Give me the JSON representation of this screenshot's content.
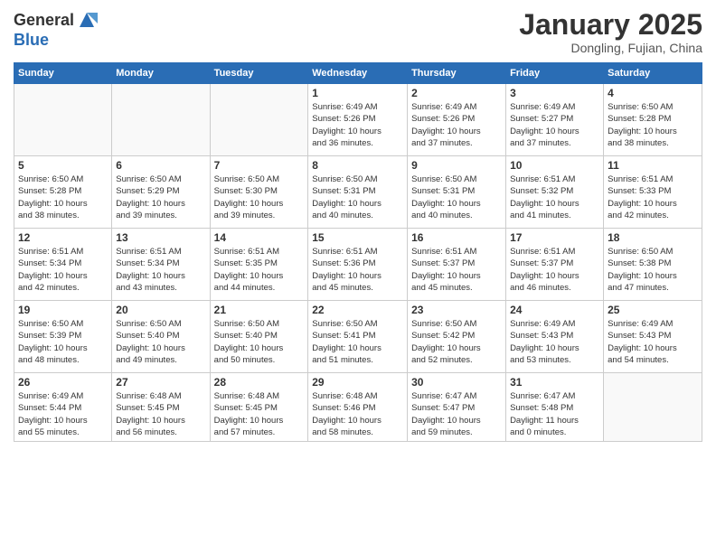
{
  "header": {
    "logo_general": "General",
    "logo_blue": "Blue",
    "month": "January 2025",
    "location": "Dongling, Fujian, China"
  },
  "weekdays": [
    "Sunday",
    "Monday",
    "Tuesday",
    "Wednesday",
    "Thursday",
    "Friday",
    "Saturday"
  ],
  "weeks": [
    [
      {
        "day": "",
        "info": ""
      },
      {
        "day": "",
        "info": ""
      },
      {
        "day": "",
        "info": ""
      },
      {
        "day": "1",
        "info": "Sunrise: 6:49 AM\nSunset: 5:26 PM\nDaylight: 10 hours\nand 36 minutes."
      },
      {
        "day": "2",
        "info": "Sunrise: 6:49 AM\nSunset: 5:26 PM\nDaylight: 10 hours\nand 37 minutes."
      },
      {
        "day": "3",
        "info": "Sunrise: 6:49 AM\nSunset: 5:27 PM\nDaylight: 10 hours\nand 37 minutes."
      },
      {
        "day": "4",
        "info": "Sunrise: 6:50 AM\nSunset: 5:28 PM\nDaylight: 10 hours\nand 38 minutes."
      }
    ],
    [
      {
        "day": "5",
        "info": "Sunrise: 6:50 AM\nSunset: 5:28 PM\nDaylight: 10 hours\nand 38 minutes."
      },
      {
        "day": "6",
        "info": "Sunrise: 6:50 AM\nSunset: 5:29 PM\nDaylight: 10 hours\nand 39 minutes."
      },
      {
        "day": "7",
        "info": "Sunrise: 6:50 AM\nSunset: 5:30 PM\nDaylight: 10 hours\nand 39 minutes."
      },
      {
        "day": "8",
        "info": "Sunrise: 6:50 AM\nSunset: 5:31 PM\nDaylight: 10 hours\nand 40 minutes."
      },
      {
        "day": "9",
        "info": "Sunrise: 6:50 AM\nSunset: 5:31 PM\nDaylight: 10 hours\nand 40 minutes."
      },
      {
        "day": "10",
        "info": "Sunrise: 6:51 AM\nSunset: 5:32 PM\nDaylight: 10 hours\nand 41 minutes."
      },
      {
        "day": "11",
        "info": "Sunrise: 6:51 AM\nSunset: 5:33 PM\nDaylight: 10 hours\nand 42 minutes."
      }
    ],
    [
      {
        "day": "12",
        "info": "Sunrise: 6:51 AM\nSunset: 5:34 PM\nDaylight: 10 hours\nand 42 minutes."
      },
      {
        "day": "13",
        "info": "Sunrise: 6:51 AM\nSunset: 5:34 PM\nDaylight: 10 hours\nand 43 minutes."
      },
      {
        "day": "14",
        "info": "Sunrise: 6:51 AM\nSunset: 5:35 PM\nDaylight: 10 hours\nand 44 minutes."
      },
      {
        "day": "15",
        "info": "Sunrise: 6:51 AM\nSunset: 5:36 PM\nDaylight: 10 hours\nand 45 minutes."
      },
      {
        "day": "16",
        "info": "Sunrise: 6:51 AM\nSunset: 5:37 PM\nDaylight: 10 hours\nand 45 minutes."
      },
      {
        "day": "17",
        "info": "Sunrise: 6:51 AM\nSunset: 5:37 PM\nDaylight: 10 hours\nand 46 minutes."
      },
      {
        "day": "18",
        "info": "Sunrise: 6:50 AM\nSunset: 5:38 PM\nDaylight: 10 hours\nand 47 minutes."
      }
    ],
    [
      {
        "day": "19",
        "info": "Sunrise: 6:50 AM\nSunset: 5:39 PM\nDaylight: 10 hours\nand 48 minutes."
      },
      {
        "day": "20",
        "info": "Sunrise: 6:50 AM\nSunset: 5:40 PM\nDaylight: 10 hours\nand 49 minutes."
      },
      {
        "day": "21",
        "info": "Sunrise: 6:50 AM\nSunset: 5:40 PM\nDaylight: 10 hours\nand 50 minutes."
      },
      {
        "day": "22",
        "info": "Sunrise: 6:50 AM\nSunset: 5:41 PM\nDaylight: 10 hours\nand 51 minutes."
      },
      {
        "day": "23",
        "info": "Sunrise: 6:50 AM\nSunset: 5:42 PM\nDaylight: 10 hours\nand 52 minutes."
      },
      {
        "day": "24",
        "info": "Sunrise: 6:49 AM\nSunset: 5:43 PM\nDaylight: 10 hours\nand 53 minutes."
      },
      {
        "day": "25",
        "info": "Sunrise: 6:49 AM\nSunset: 5:43 PM\nDaylight: 10 hours\nand 54 minutes."
      }
    ],
    [
      {
        "day": "26",
        "info": "Sunrise: 6:49 AM\nSunset: 5:44 PM\nDaylight: 10 hours\nand 55 minutes."
      },
      {
        "day": "27",
        "info": "Sunrise: 6:48 AM\nSunset: 5:45 PM\nDaylight: 10 hours\nand 56 minutes."
      },
      {
        "day": "28",
        "info": "Sunrise: 6:48 AM\nSunset: 5:45 PM\nDaylight: 10 hours\nand 57 minutes."
      },
      {
        "day": "29",
        "info": "Sunrise: 6:48 AM\nSunset: 5:46 PM\nDaylight: 10 hours\nand 58 minutes."
      },
      {
        "day": "30",
        "info": "Sunrise: 6:47 AM\nSunset: 5:47 PM\nDaylight: 10 hours\nand 59 minutes."
      },
      {
        "day": "31",
        "info": "Sunrise: 6:47 AM\nSunset: 5:48 PM\nDaylight: 11 hours\nand 0 minutes."
      },
      {
        "day": "",
        "info": ""
      }
    ]
  ]
}
